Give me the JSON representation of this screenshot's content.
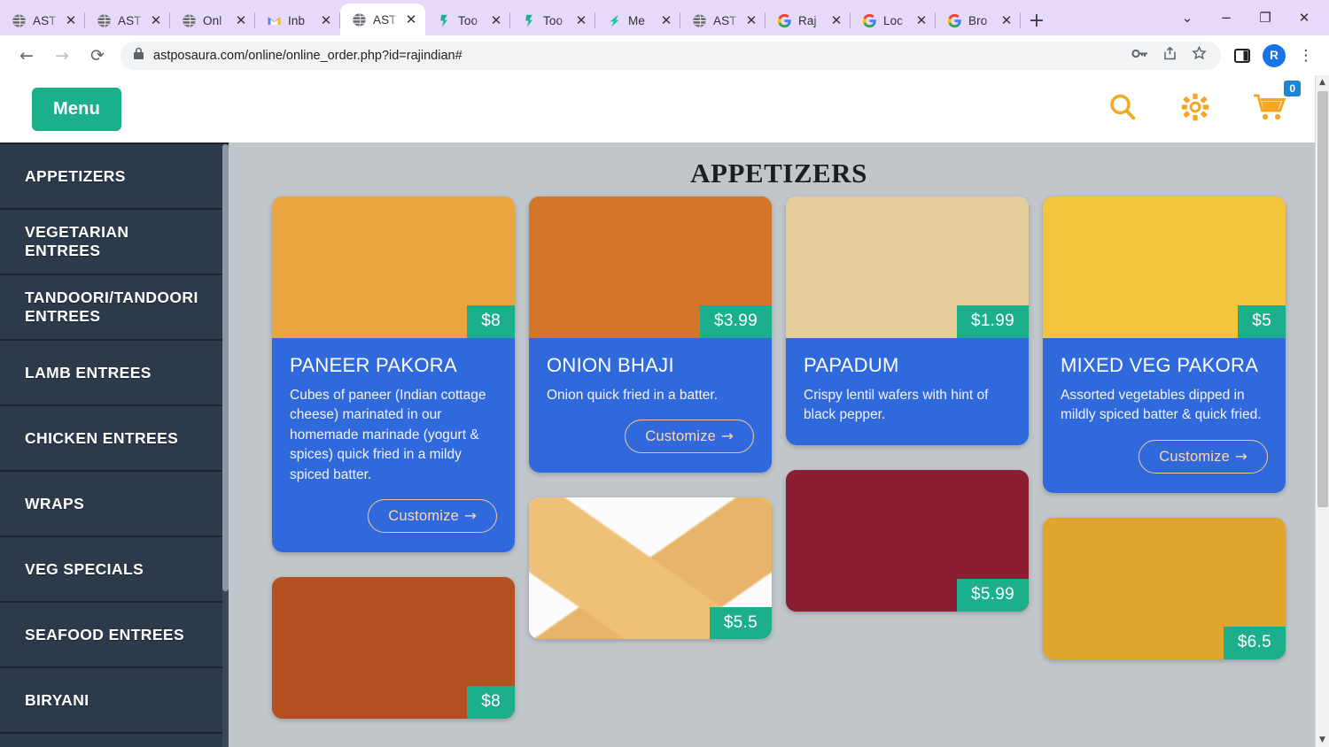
{
  "browser": {
    "tabs": [
      {
        "label": "AST",
        "favicon": "globe-icon",
        "active": false
      },
      {
        "label": "AST",
        "favicon": "globe-icon",
        "active": false
      },
      {
        "label": "Onl",
        "favicon": "globe-icon",
        "active": false
      },
      {
        "label": "Inb",
        "favicon": "gmail-icon",
        "active": false
      },
      {
        "label": "AST",
        "favicon": "globe-icon",
        "active": true
      },
      {
        "label": "Too",
        "favicon": "green-app-icon",
        "active": false
      },
      {
        "label": "Too",
        "favicon": "green-app-icon",
        "active": false
      },
      {
        "label": "Me",
        "favicon": "green-bolt-icon",
        "active": false
      },
      {
        "label": "AST",
        "favicon": "globe-icon",
        "active": false
      },
      {
        "label": "Raj",
        "favicon": "google-icon",
        "active": false
      },
      {
        "label": "Loc",
        "favicon": "google-icon",
        "active": false
      },
      {
        "label": "Bro",
        "favicon": "google-icon",
        "active": false
      }
    ],
    "tab_close_label": "✕",
    "new_tab_label": "+",
    "window": {
      "tab_search": "⌄",
      "minimize": "−",
      "maximize": "❐",
      "close": "✕"
    },
    "toolbar": {
      "back": "←",
      "forward": "→",
      "reload": "⟳",
      "url": "astposaura.com/online/online_order.php?id=rajindian#",
      "lock": "lock-icon",
      "password_key": "key-icon",
      "share": "share-icon",
      "bookmark": "star-icon",
      "side_panel": "side-panel-icon",
      "profile_initial": "R",
      "menu": "⋮"
    }
  },
  "site": {
    "menu_button": "Menu",
    "header_icons": {
      "search": "search-icon",
      "settings": "gear-icon",
      "cart": "cart-icon",
      "cart_count": "0"
    },
    "sidebar": {
      "items": [
        {
          "label": "APPETIZERS"
        },
        {
          "label": "VEGETARIAN ENTREES"
        },
        {
          "label": "TANDOORI/TANDOORI ENTREES"
        },
        {
          "label": "LAMB ENTREES"
        },
        {
          "label": "CHICKEN ENTREES"
        },
        {
          "label": "WRAPS"
        },
        {
          "label": "VEG SPECIALS"
        },
        {
          "label": "SEAFOOD ENTREES"
        },
        {
          "label": "BIRYANI"
        }
      ]
    },
    "page_title": "APPETIZERS",
    "customize_label": "Customize",
    "customize_arrow": "→",
    "items": [
      {
        "name": "PANEER PAKORA",
        "price": "$8",
        "description": "Cubes of paneer (Indian cottage cheese) marinated in our homemade marinade (yogurt & spices) quick fried in a mildy spiced batter.",
        "has_customize": true,
        "art": "f1"
      },
      {
        "name": "ONION BHAJI",
        "price": "$3.99",
        "description": "Onion quick fried in a batter.",
        "has_customize": true,
        "art": "f2"
      },
      {
        "name": "PAPADUM",
        "price": "$1.99",
        "description": "Crispy lentil wafers with hint of black pepper.",
        "has_customize": false,
        "art": "f3"
      },
      {
        "name": "MIXED VEG PAKORA",
        "price": "$5",
        "description": "Assorted vegetables dipped in mildly spiced batter & quick fried.",
        "has_customize": true,
        "art": "f4"
      },
      {
        "name": "",
        "price": "$8",
        "description": "",
        "has_customize": false,
        "art": "f5"
      },
      {
        "name": "",
        "price": "$5.5",
        "description": "",
        "has_customize": false,
        "art": "f6"
      },
      {
        "name": "",
        "price": "$5.99",
        "description": "",
        "has_customize": false,
        "art": "f7"
      },
      {
        "name": "",
        "price": "$6.5",
        "description": "",
        "has_customize": false,
        "art": "f8"
      }
    ]
  },
  "colors": {
    "brand_green": "#1CAF8C",
    "card_blue": "#3069DC",
    "sidebar_navy": "#2C3A4B",
    "accent_orange": "#F5A623",
    "badge_blue": "#1C86D6",
    "page_bg": "#C1C6CB",
    "chrome_purple": "#E6D9FA"
  }
}
